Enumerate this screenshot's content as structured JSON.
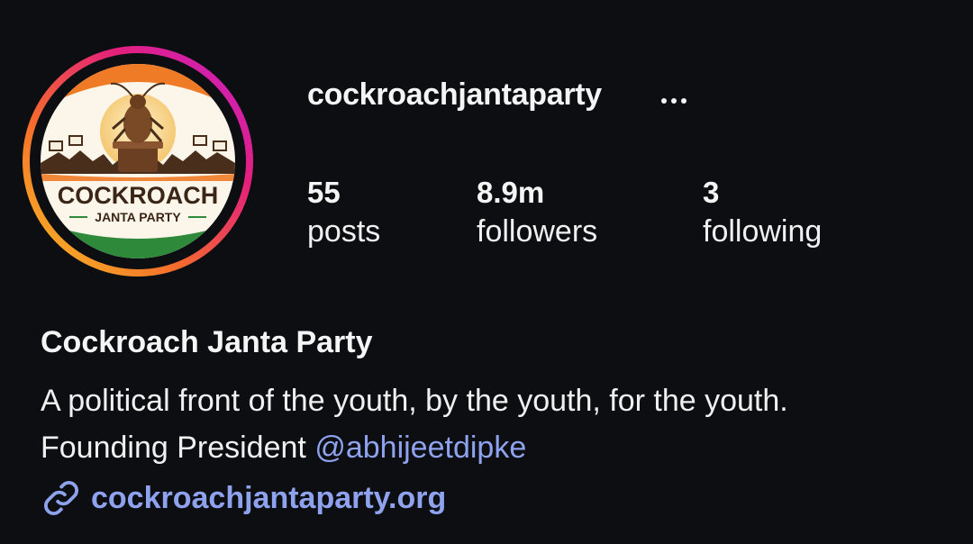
{
  "profile": {
    "username": "cockroachjantaparty",
    "full_name": "Cockroach Janta Party",
    "avatar": {
      "logo_line1": "COCKROACH",
      "logo_line2": "JANTA PARTY",
      "ring_colors": [
        "#f9c323",
        "#f56c2c",
        "#e4207b",
        "#c21fd1"
      ]
    },
    "more_icon": "more-horizontal-icon"
  },
  "stats": {
    "posts": {
      "value": "55",
      "label": "posts"
    },
    "followers": {
      "value": "8.9m",
      "label": "followers"
    },
    "following": {
      "value": "3",
      "label": "following"
    }
  },
  "bio": {
    "line1": "A political front of the youth, by the youth, for the youth.",
    "line2_prefix": "Founding President",
    "mention": "@abhijeetdipke"
  },
  "website": {
    "icon": "link-icon",
    "text": "cockroachjantaparty.org"
  },
  "colors": {
    "background": "#0c0e12",
    "text": "#f5f5f5",
    "link": "#8ea2ee",
    "saffron": "#f07b26",
    "green": "#2e8a3a"
  }
}
